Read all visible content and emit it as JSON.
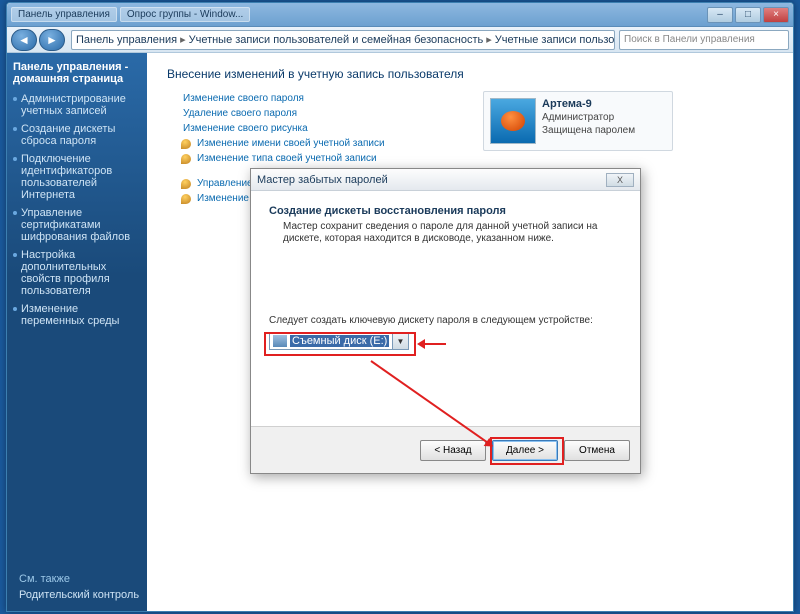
{
  "titlebar": {
    "tab1": "Панель управления",
    "tab2": "Опрос группы - Window..."
  },
  "breadcrumb": {
    "seg1": "Панель управления",
    "seg2": "Учетные записи пользователей и семейная безопасность",
    "seg3": "Учетные записи пользователей"
  },
  "search": {
    "placeholder": "Поиск в Панели управления"
  },
  "sidebar": {
    "home": "Панель управления - домашняя страница",
    "items": [
      "Администрирование учетных записей",
      "Создание дискеты сброса пароля",
      "Подключение идентификаторов пользователей Интернета",
      "Управление сертификатами шифрования файлов",
      "Настройка дополнительных свойств профиля пользователя",
      "Изменение переменных среды"
    ],
    "seealso": "См. также",
    "parental": "Родительский контроль"
  },
  "content": {
    "heading": "Внесение изменений в учетную запись пользователя",
    "links": [
      "Изменение своего пароля",
      "Удаление своего пароля",
      "Изменение своего рисунка",
      "Изменение имени своей учетной записи",
      "Изменение типа своей учетной записи"
    ],
    "extra1": "Управление другой учетной записью",
    "extra2": "Изменение параметров контроля учетных записей"
  },
  "user": {
    "name": "Артема-9",
    "role": "Администратор",
    "prot": "Защищена паролем"
  },
  "dialog": {
    "title": "Мастер забытых паролей",
    "heading": "Создание дискеты восстановления пароля",
    "desc": "Мастер сохранит сведения о пароле для данной учетной записи на дискете, которая находится в дисководе, указанном ниже.",
    "label": "Следует создать ключевую дискету пароля в следующем устройстве:",
    "combo": "Съемный диск (E:)",
    "back": "< Назад",
    "next": "Далее >",
    "cancel": "Отмена",
    "x": "X"
  }
}
